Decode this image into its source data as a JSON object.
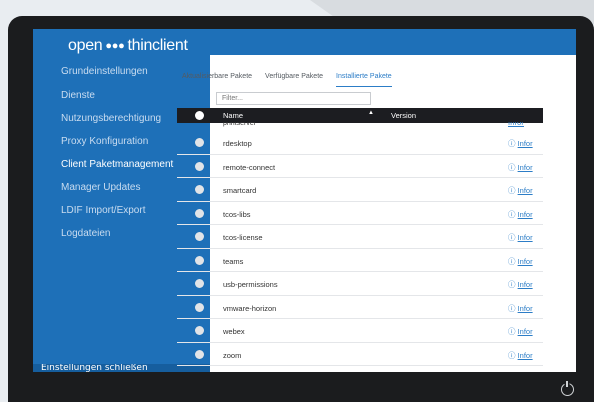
{
  "app": {
    "logo_text_1": "open",
    "logo_text_2": "thinclient"
  },
  "sidebar": {
    "items": [
      {
        "label": "Grundeinstellungen"
      },
      {
        "label": "Dienste"
      },
      {
        "label": "Nutzungsberechtigung"
      },
      {
        "label": "Proxy Konfiguration"
      },
      {
        "label": "Client Paketmanagement"
      },
      {
        "label": "Manager Updates"
      },
      {
        "label": "LDIF Import/Export"
      },
      {
        "label": "Logdateien"
      }
    ],
    "active_index": 4,
    "footer": "Einstellungen schließen"
  },
  "tabs": [
    {
      "label": "Aktualisierbare Pakete"
    },
    {
      "label": "Verfügbare Pakete"
    },
    {
      "label": "Installierte Pakete"
    }
  ],
  "filter": {
    "placeholder": "Filter..."
  },
  "table": {
    "headers": {
      "name": "Name",
      "sort": "▲",
      "version": "Version"
    },
    "partial_row": {
      "name": "printserver",
      "info": "Infor"
    },
    "rows": [
      {
        "name": "rdesktop",
        "info": "Infor"
      },
      {
        "name": "remote-connect",
        "info": "Infor"
      },
      {
        "name": "smartcard",
        "info": "Infor"
      },
      {
        "name": "tcos-libs",
        "info": "Infor"
      },
      {
        "name": "tcos-license",
        "info": "Infor"
      },
      {
        "name": "teams",
        "info": "Infor"
      },
      {
        "name": "usb-permissions",
        "info": "Infor"
      },
      {
        "name": "vmware-horizon",
        "info": "Infor"
      },
      {
        "name": "webex",
        "info": "Infor"
      },
      {
        "name": "zoom",
        "info": "Infor"
      }
    ],
    "info_icon": "ⓘ"
  },
  "colors": {
    "sidebar": "#1e70b8",
    "header": "#1c1d21",
    "accent": "#2c7dc7",
    "bezel": "#1b1c1e"
  },
  "icons": {
    "logo": "people-icon",
    "power": "power-icon"
  }
}
